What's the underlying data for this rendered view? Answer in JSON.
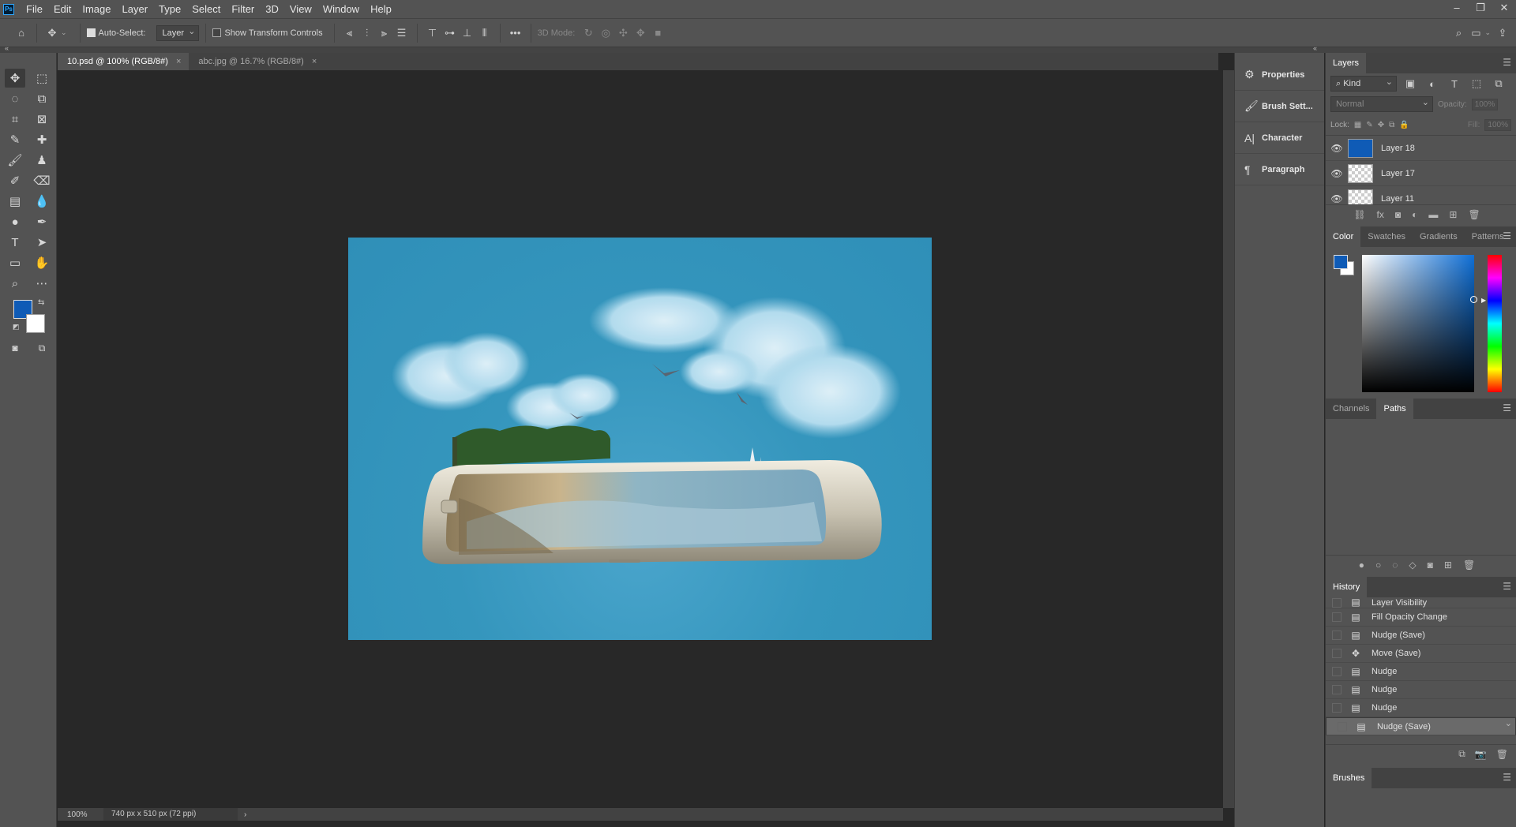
{
  "menubar": {
    "logo": "Ps",
    "items": [
      "File",
      "Edit",
      "Image",
      "Layer",
      "Type",
      "Select",
      "Filter",
      "3D",
      "View",
      "Window",
      "Help"
    ]
  },
  "options": {
    "auto_select_label": "Auto-Select:",
    "auto_select_target": "Layer",
    "show_transform_label": "Show Transform Controls",
    "mode_3d_label": "3D Mode:"
  },
  "tabs": [
    {
      "label": "10.psd @ 100% (RGB/8#)",
      "active": true
    },
    {
      "label": "abc.jpg @ 16.7% (RGB/8#)",
      "active": false
    }
  ],
  "status": {
    "zoom": "100%",
    "doc_info": "740 px x 510 px (72 ppi)"
  },
  "icon_panel": [
    {
      "label": "Properties",
      "icon": "properties-icon"
    },
    {
      "label": "Brush Sett...",
      "icon": "brush-settings-icon"
    },
    {
      "label": "Character",
      "icon": "character-icon"
    },
    {
      "label": "Paragraph",
      "icon": "paragraph-icon"
    }
  ],
  "layers": {
    "title": "Layers",
    "filter": "Kind",
    "blend": "Normal",
    "opacity_label": "Opacity:",
    "opacity": "100%",
    "lock_label": "Lock:",
    "fill_label": "Fill:",
    "fill": "100%",
    "items": [
      {
        "name": "Layer 18",
        "thumb": "blue"
      },
      {
        "name": "Layer 17",
        "thumb": "transparent"
      },
      {
        "name": "Layer 11",
        "thumb": "transparent"
      }
    ]
  },
  "color_panel": {
    "tabs": [
      "Color",
      "Swatches",
      "Gradients",
      "Patterns"
    ],
    "foreground": "#0f5bb6",
    "background": "#ffffff"
  },
  "paths_panel": {
    "tabs": [
      "Channels",
      "Paths"
    ]
  },
  "history": {
    "title": "History",
    "items": [
      {
        "label": "Layer Visibility",
        "icon": "doc"
      },
      {
        "label": "Fill Opacity Change",
        "icon": "doc"
      },
      {
        "label": "Nudge (Save)",
        "icon": "doc"
      },
      {
        "label": "Move (Save)",
        "icon": "move"
      },
      {
        "label": "Nudge",
        "icon": "doc"
      },
      {
        "label": "Nudge",
        "icon": "doc"
      },
      {
        "label": "Nudge",
        "icon": "doc"
      },
      {
        "label": "Nudge (Save)",
        "icon": "doc",
        "selected": true
      }
    ]
  },
  "brushes": {
    "title": "Brushes"
  }
}
